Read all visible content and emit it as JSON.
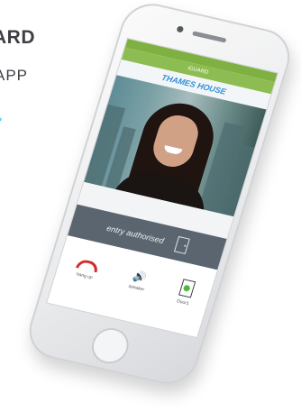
{
  "promo": {
    "brand_fragment": "ARD",
    "app_fragment": "APP"
  },
  "phone_app": {
    "status_bar": {
      "carrier": "",
      "time": "",
      "battery": ""
    },
    "header_title": "iGUARD",
    "location_name": "THAMES HOUSE",
    "entry_status": "entry authorised",
    "controls": [
      {
        "label": "hang up",
        "icon": "hangup-icon",
        "color": "#d42a2a"
      },
      {
        "label": "speaker",
        "icon": "speaker-icon",
        "color": "#4a4f55"
      },
      {
        "label": "Door1",
        "icon": "door-open-icon",
        "color": "#4db83a"
      }
    ]
  },
  "colors": {
    "app_green": "#8dbd52",
    "location_blue": "#2f8fd6",
    "entry_bar_grey": "#5a6570",
    "link_cyan": "#35b6e0"
  }
}
